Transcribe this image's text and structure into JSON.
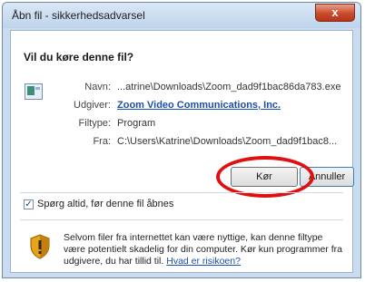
{
  "window": {
    "title": "Åbn fil - sikkerhedsadvarsel",
    "close_glyph": "x"
  },
  "dialog": {
    "question": "Vil du køre denne fil?",
    "fields": {
      "name": {
        "label": "Navn:",
        "value": "...atrine\\Downloads\\Zoom_dad9f1bac86da783.exe"
      },
      "publisher": {
        "label": "Udgiver:",
        "value": "Zoom Video Communications, Inc."
      },
      "type": {
        "label": "Filtype:",
        "value": "Program"
      },
      "from": {
        "label": "Fra:",
        "value": "C:\\Users\\Katrine\\Downloads\\Zoom_dad9f1bac8..."
      }
    },
    "buttons": {
      "run": "Kør",
      "cancel": "Annuller"
    },
    "checkbox": {
      "label": "Spørg altid, før denne fil åbnes",
      "checked": true
    },
    "warning": {
      "text": "Selvom filer fra internettet kan være nyttige, kan denne filtype være potentielt skadelig for din computer. Kør kun programmer fra udgivere, du har tillid til.",
      "link": "Hvad er risikoen?"
    }
  },
  "colors": {
    "highlight": "#e01010",
    "link": "#1a4fb0"
  },
  "icons": {
    "file": "program-file-icon",
    "warning": "security-shield-icon",
    "check": "checkmark-icon"
  }
}
